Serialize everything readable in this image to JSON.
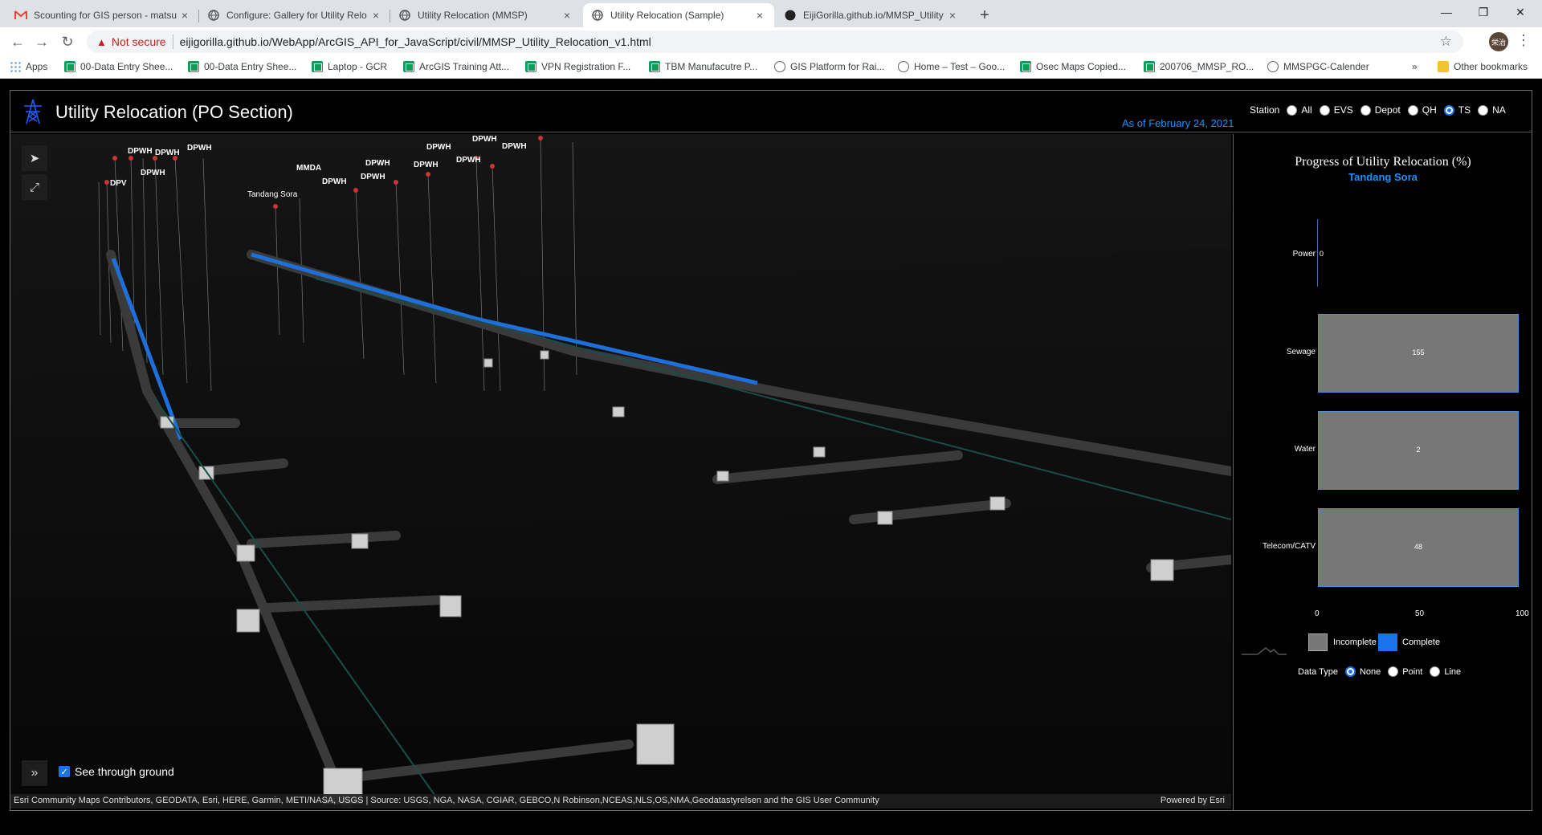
{
  "browser": {
    "tabs": [
      {
        "title": "Scounting for GIS person - matsu",
        "icon": "gmail-icon"
      },
      {
        "title": "Configure: Gallery for Utility Relo",
        "icon": "globe-icon"
      },
      {
        "title": "Utility Relocation (MMSP)",
        "icon": "globe-icon"
      },
      {
        "title": "Utility Relocation (Sample)",
        "icon": "globe-icon",
        "active": true
      },
      {
        "title": "EijiGorilla.github.io/MMSP_Utility",
        "icon": "github-icon"
      }
    ],
    "not_secure": "Not secure",
    "url": "eijigorilla.github.io/WebApp/ArcGIS_API_for_JavaScript/civil/MMSP_Utility_Relocation_v1.html",
    "profile": "栄治",
    "bookmarks": [
      {
        "label": "Apps",
        "icon": "apps-icon"
      },
      {
        "label": "00-Data Entry Shee...",
        "icon": "sheets-icon"
      },
      {
        "label": "00-Data Entry Shee...",
        "icon": "sheets-icon"
      },
      {
        "label": "Laptop - GCR",
        "icon": "sheets-icon"
      },
      {
        "label": "ArcGIS Training Att...",
        "icon": "sheets-icon"
      },
      {
        "label": "VPN Registration F...",
        "icon": "sheets-icon"
      },
      {
        "label": "TBM Manufacutre P...",
        "icon": "sheets-icon"
      },
      {
        "label": "GIS Platform for Rai...",
        "icon": "globe-icon"
      },
      {
        "label": "Home – Test – Goo...",
        "icon": "gear-icon"
      },
      {
        "label": "Osec Maps Copied...",
        "icon": "sheets-icon"
      },
      {
        "label": "200706_MMSP_RO...",
        "icon": "sheets-icon"
      },
      {
        "label": "MMSPGC-Calender",
        "icon": "link-icon"
      }
    ],
    "other_bookmarks": "Other bookmarks",
    "more_bookmarks": "»"
  },
  "app": {
    "title": "Utility Relocation (PO Section)",
    "as_of": "As of February 24, 2021",
    "station_label": "Station",
    "stations": [
      {
        "label": "All",
        "selected": false
      },
      {
        "label": "EVS",
        "selected": false
      },
      {
        "label": "Depot",
        "selected": false
      },
      {
        "label": "QH",
        "selected": false
      },
      {
        "label": "TS",
        "selected": true
      },
      {
        "label": "NA",
        "selected": false
      }
    ],
    "see_through": "See through ground",
    "attribution": "Esri Community Maps Contributors, GEODATA, Esri, HERE, Garmin, METI/NASA, USGS | Source: USGS, NGA, NASA, CGIAR, GEBCO,N Robinson,NCEAS,NLS,OS,NMA,Geodatastyrelsen and the GIS User Community",
    "powered": "Powered by Esri",
    "map_labels": [
      {
        "text": "DPWH"
      },
      {
        "text": "DPWH"
      },
      {
        "text": "DPWH"
      },
      {
        "text": "DPWH"
      },
      {
        "text": "DPV"
      },
      {
        "text": "MMDA"
      },
      {
        "text": "DPWH"
      },
      {
        "text": "DPWH"
      },
      {
        "text": "DPWH"
      },
      {
        "text": "DPWH"
      },
      {
        "text": "DPWH"
      },
      {
        "text": "DPWH"
      },
      {
        "text": "DPWH"
      },
      {
        "text": "DPWH"
      },
      {
        "text": "Tandang Sora",
        "plain": true
      }
    ]
  },
  "panel": {
    "title": "Progress of Utility Relocation (%)",
    "subtitle": "Tandang Sora",
    "legend": {
      "incomplete": "Incomplete",
      "complete": "Complete"
    },
    "data_type_label": "Data Type",
    "data_types": [
      {
        "label": "None",
        "selected": true
      },
      {
        "label": "Point",
        "selected": false
      },
      {
        "label": "Line",
        "selected": false
      }
    ]
  },
  "chart_data": {
    "type": "bar",
    "title": "Progress of Utility Relocation (%)",
    "subtitle": "Tandang Sora",
    "orientation": "horizontal",
    "stacked": true,
    "categories": [
      "Power",
      "Sewage",
      "Water",
      "Telecom/CATV"
    ],
    "series": [
      {
        "name": "Complete",
        "values": [
          0,
          0,
          0,
          0
        ],
        "labels": [
          "0",
          "",
          "",
          ""
        ]
      },
      {
        "name": "Incomplete",
        "values": [
          0,
          100,
          100,
          100
        ],
        "labels": [
          "",
          "155",
          "2",
          "48"
        ]
      }
    ],
    "xlim": [
      0,
      100
    ],
    "ticks": [
      "0",
      "50",
      "100"
    ],
    "colors": {
      "Incomplete": "#777777",
      "Complete": "#1a73e8"
    }
  }
}
